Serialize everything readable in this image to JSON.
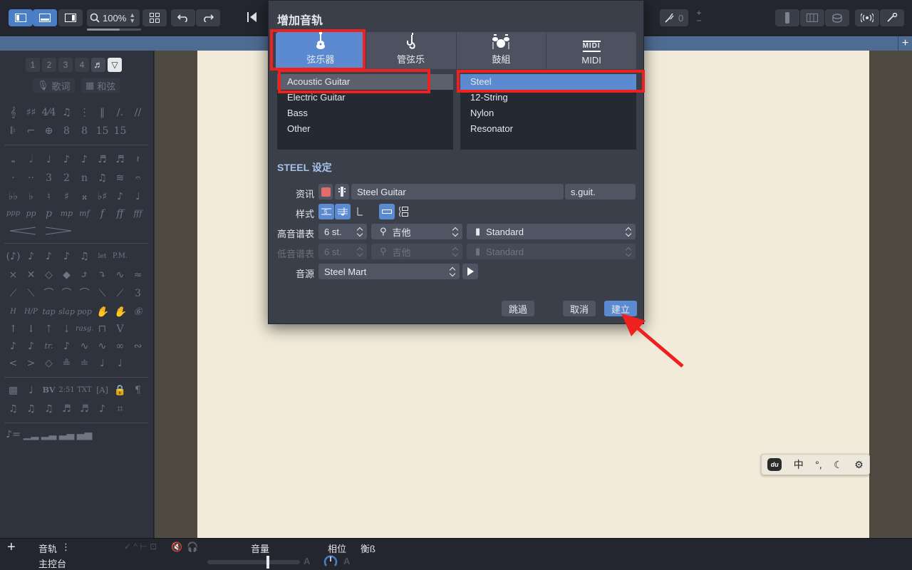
{
  "toolbar": {
    "zoom_level": "100%"
  },
  "palette": {
    "voices": [
      "1",
      "2",
      "3",
      "4"
    ],
    "lyrics_label": "歌词",
    "chord_label": "和弦"
  },
  "dialog": {
    "title": "增加音轨",
    "categories": [
      {
        "label": "弦乐器",
        "icon": "guitar-icon"
      },
      {
        "label": "管弦乐",
        "icon": "saxophone-icon"
      },
      {
        "label": "鼓組",
        "icon": "drum-kit-icon"
      },
      {
        "label": "MIDI",
        "icon": "midi-icon",
        "icon_text": "MIDI"
      }
    ],
    "instrument_list": [
      "Acoustic Guitar",
      "Electric Guitar",
      "Bass",
      "Other"
    ],
    "variant_list": [
      "Steel",
      "12-String",
      "Nylon",
      "Resonator"
    ],
    "settings_title": "STEEL 设定",
    "info_label": "资讯",
    "track_name": "Steel Guitar",
    "track_short_name": "s.guit.",
    "track_color": "#e06c6c",
    "style_label": "样式",
    "treble_label": "高音谱表",
    "treble_strings": "6 st.",
    "treble_instrument": "吉他",
    "treble_tuning": "Standard",
    "bass_label": "低音谱表",
    "bass_strings": "6 st.",
    "bass_instrument": "吉他",
    "bass_tuning": "Standard",
    "sound_label": "音源",
    "sound_bank": "Steel Mart",
    "skip_button": "跳過",
    "cancel_button": "取消",
    "create_button": "建立"
  },
  "tuner": {
    "value": "0"
  },
  "mixer": {
    "add_symbol": "+",
    "track_label": "音轨",
    "master_label": "主控台",
    "volume_label": "音量",
    "pan_label": "相位",
    "balance_label": "衡ß"
  },
  "ime": {
    "logo": "du",
    "mode": "中",
    "punct": "°,",
    "moon": "☾",
    "gear": "⚙"
  },
  "colors": {
    "accent": "#5b8ad0",
    "annotation": "#ee2020"
  }
}
